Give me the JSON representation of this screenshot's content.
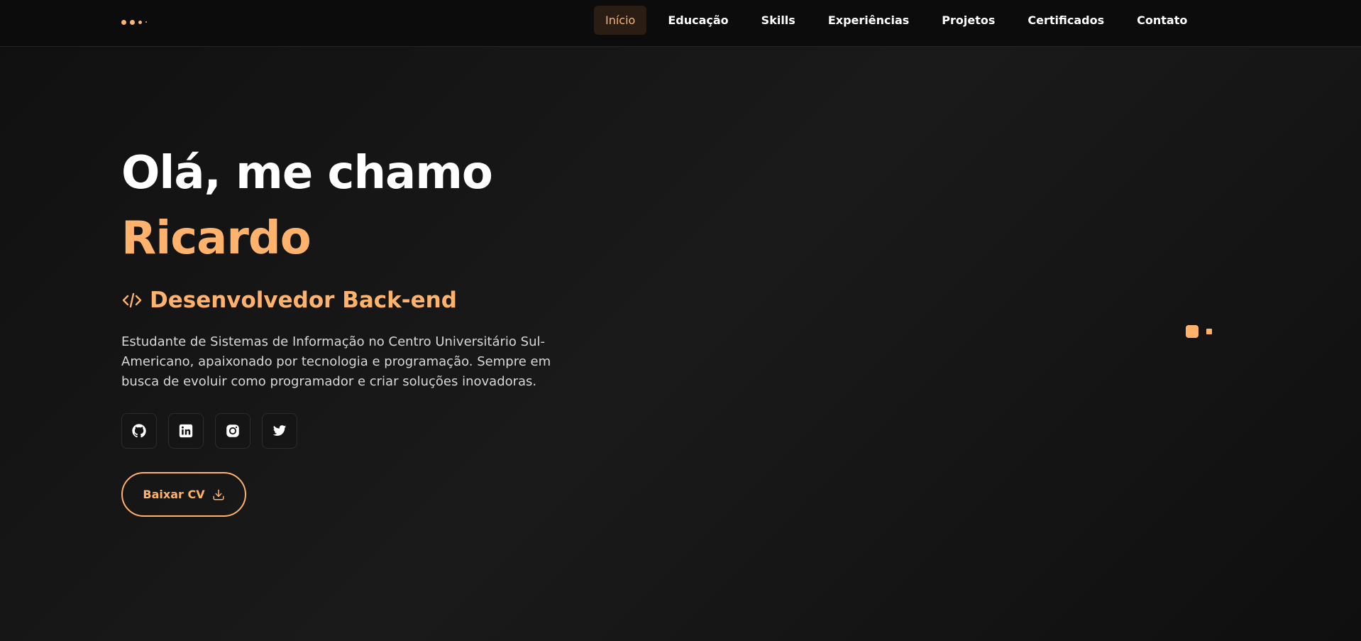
{
  "nav": {
    "items": [
      {
        "label": "Início",
        "active": true
      },
      {
        "label": "Educação",
        "active": false
      },
      {
        "label": "Skills",
        "active": false
      },
      {
        "label": "Experiências",
        "active": false
      },
      {
        "label": "Projetos",
        "active": false
      },
      {
        "label": "Certificados",
        "active": false
      },
      {
        "label": "Contato",
        "active": false
      }
    ]
  },
  "hero": {
    "greeting": "Olá, me chamo",
    "name": "Ricardo",
    "role": "Desenvolvedor Back-end",
    "bio": "Estudante de Sistemas de Informação no Centro Universitário Sul-Americano, apaixonado por tecnologia e programação. Sempre em busca de evoluir como programador e criar soluções inovadoras.",
    "cv_button": "Baixar CV"
  },
  "socials": [
    {
      "icon": "github-icon"
    },
    {
      "icon": "linkedin-icon"
    },
    {
      "icon": "instagram-icon"
    },
    {
      "icon": "twitter-icon"
    }
  ],
  "carousel": {
    "slides": 2,
    "active_index": 0
  },
  "colors": {
    "accent": "#ffb26b",
    "background": "#121212",
    "text": "#ffffff",
    "muted_text": "#d8d8d8"
  }
}
